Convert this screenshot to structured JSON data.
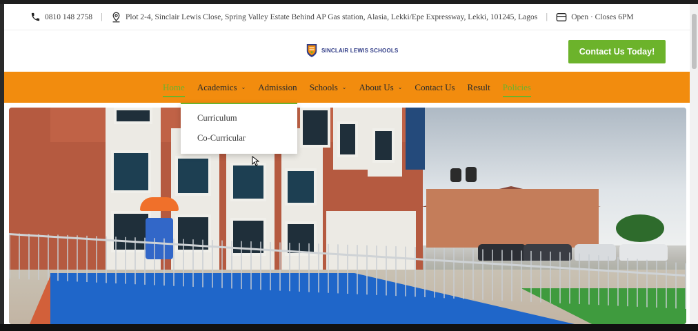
{
  "infobar": {
    "phone": "0810 148 2758",
    "address": "Plot 2-4, Sinclair Lewis Close, Spring Valley Estate Behind AP Gas station, Alasia, Lekki/Epe Expressway, Lekki, 101245, Lagos",
    "hours": "Open · Closes 6PM",
    "icons": [
      "phone-icon",
      "location-pin-icon",
      "clock-box-icon"
    ]
  },
  "header": {
    "logo_text": "SINCLAIR LEWIS SCHOOLS",
    "cta_label": "Contact Us Today!"
  },
  "nav": {
    "items": [
      {
        "label": "Home",
        "has_caret": false,
        "active": true
      },
      {
        "label": "Academics",
        "has_caret": true,
        "active": false
      },
      {
        "label": "Admission",
        "has_caret": false,
        "active": false
      },
      {
        "label": "Schools",
        "has_caret": true,
        "active": false
      },
      {
        "label": "About Us",
        "has_caret": true,
        "active": false
      },
      {
        "label": "Contact Us",
        "has_caret": false,
        "active": false
      },
      {
        "label": "Result",
        "has_caret": false,
        "active": false
      },
      {
        "label": "Policies",
        "has_caret": false,
        "active": true
      }
    ],
    "caret_glyph": "⌄"
  },
  "dropdown": {
    "items": [
      "Curriculum",
      "Co-Curricular"
    ]
  },
  "colors": {
    "nav_bg": "#f28c0e",
    "accent_green": "#6cb32b",
    "text_dark": "#2b2b2b"
  }
}
